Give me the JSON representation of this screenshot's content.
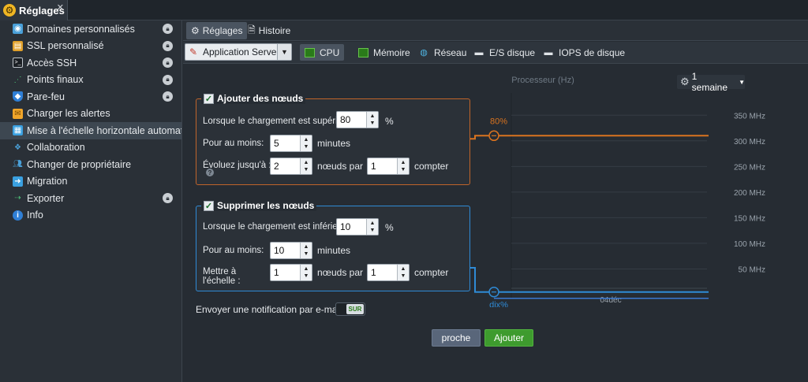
{
  "window_tab": {
    "title": "Réglages",
    "close": "✕"
  },
  "sidebar": {
    "items": [
      {
        "label": "Domaines personnalisés",
        "locked": true
      },
      {
        "label": "SSL personnalisé",
        "locked": true
      },
      {
        "label": "Accès SSH",
        "locked": true
      },
      {
        "label": "Points finaux",
        "locked": true
      },
      {
        "label": "Pare-feu",
        "locked": true
      },
      {
        "label": "Charger les alertes",
        "locked": false
      },
      {
        "label": "Mise à l'échelle horizontale automatique",
        "locked": false,
        "active": true
      },
      {
        "label": "Collaboration",
        "locked": false
      },
      {
        "label": "Changer de propriétaire",
        "locked": false
      },
      {
        "label": "Migration",
        "locked": false
      },
      {
        "label": "Exporter",
        "locked": true
      },
      {
        "label": "Info",
        "locked": false
      }
    ]
  },
  "subtabs": {
    "settings": "Réglages",
    "history": "Histoire"
  },
  "toolbar": {
    "node_group": "Application Servers",
    "metrics": {
      "cpu": "CPU",
      "memory": "Mémoire",
      "network": "Réseau",
      "disk_io": "E/S disque",
      "disk_iops": "IOPS de disque"
    }
  },
  "add_nodes": {
    "title": "Ajouter des nœuds",
    "when_label": "Lorsque le chargement est supérieur à",
    "when_value": "80",
    "percent": "%",
    "for_label": "Pour au moins:",
    "for_value": "5",
    "minutes": "minutes",
    "scale_label": "Évoluez jusqu'à :",
    "scale_value": "2",
    "nodes_by": "nœuds par",
    "step_value": "1",
    "count": "compter",
    "help": "?"
  },
  "remove_nodes": {
    "title": "Supprimer les nœuds",
    "when_label": "Lorsque le chargement est inférieur à",
    "when_value": "10",
    "percent": "%",
    "for_label": "Pour au moins:",
    "for_value": "10",
    "minutes": "minutes",
    "scale_label_1": "Mettre à",
    "scale_label_2": "l'échelle :",
    "scale_value": "1",
    "nodes_by": "nœuds par",
    "step_value": "1",
    "count": "compter"
  },
  "notification": {
    "label": "Envoyer une notification par e-mail :",
    "toggle": "SUR"
  },
  "buttons": {
    "close": "proche",
    "add": "Ajouter"
  },
  "range": {
    "label": "1 semaine"
  },
  "colors": {
    "upper": "#d9731f",
    "lower": "#2f8bd6",
    "accent_green": "#3e9b2e"
  },
  "chart_data": {
    "type": "line",
    "title": "Processeur (Hz)",
    "y_ticks": [
      "350 MHz",
      "300 MHz",
      "250 MHz",
      "200 MHz",
      "150 MHz",
      "100 MHz",
      "50 MHz"
    ],
    "y_tick_values": [
      350,
      300,
      250,
      200,
      150,
      100,
      50
    ],
    "ylim": [
      0,
      375
    ],
    "x_ticks": [
      "04déc"
    ],
    "upper_threshold": {
      "label": "80%",
      "value": 310
    },
    "lower_threshold": {
      "label": "dix%",
      "value": 5
    }
  }
}
